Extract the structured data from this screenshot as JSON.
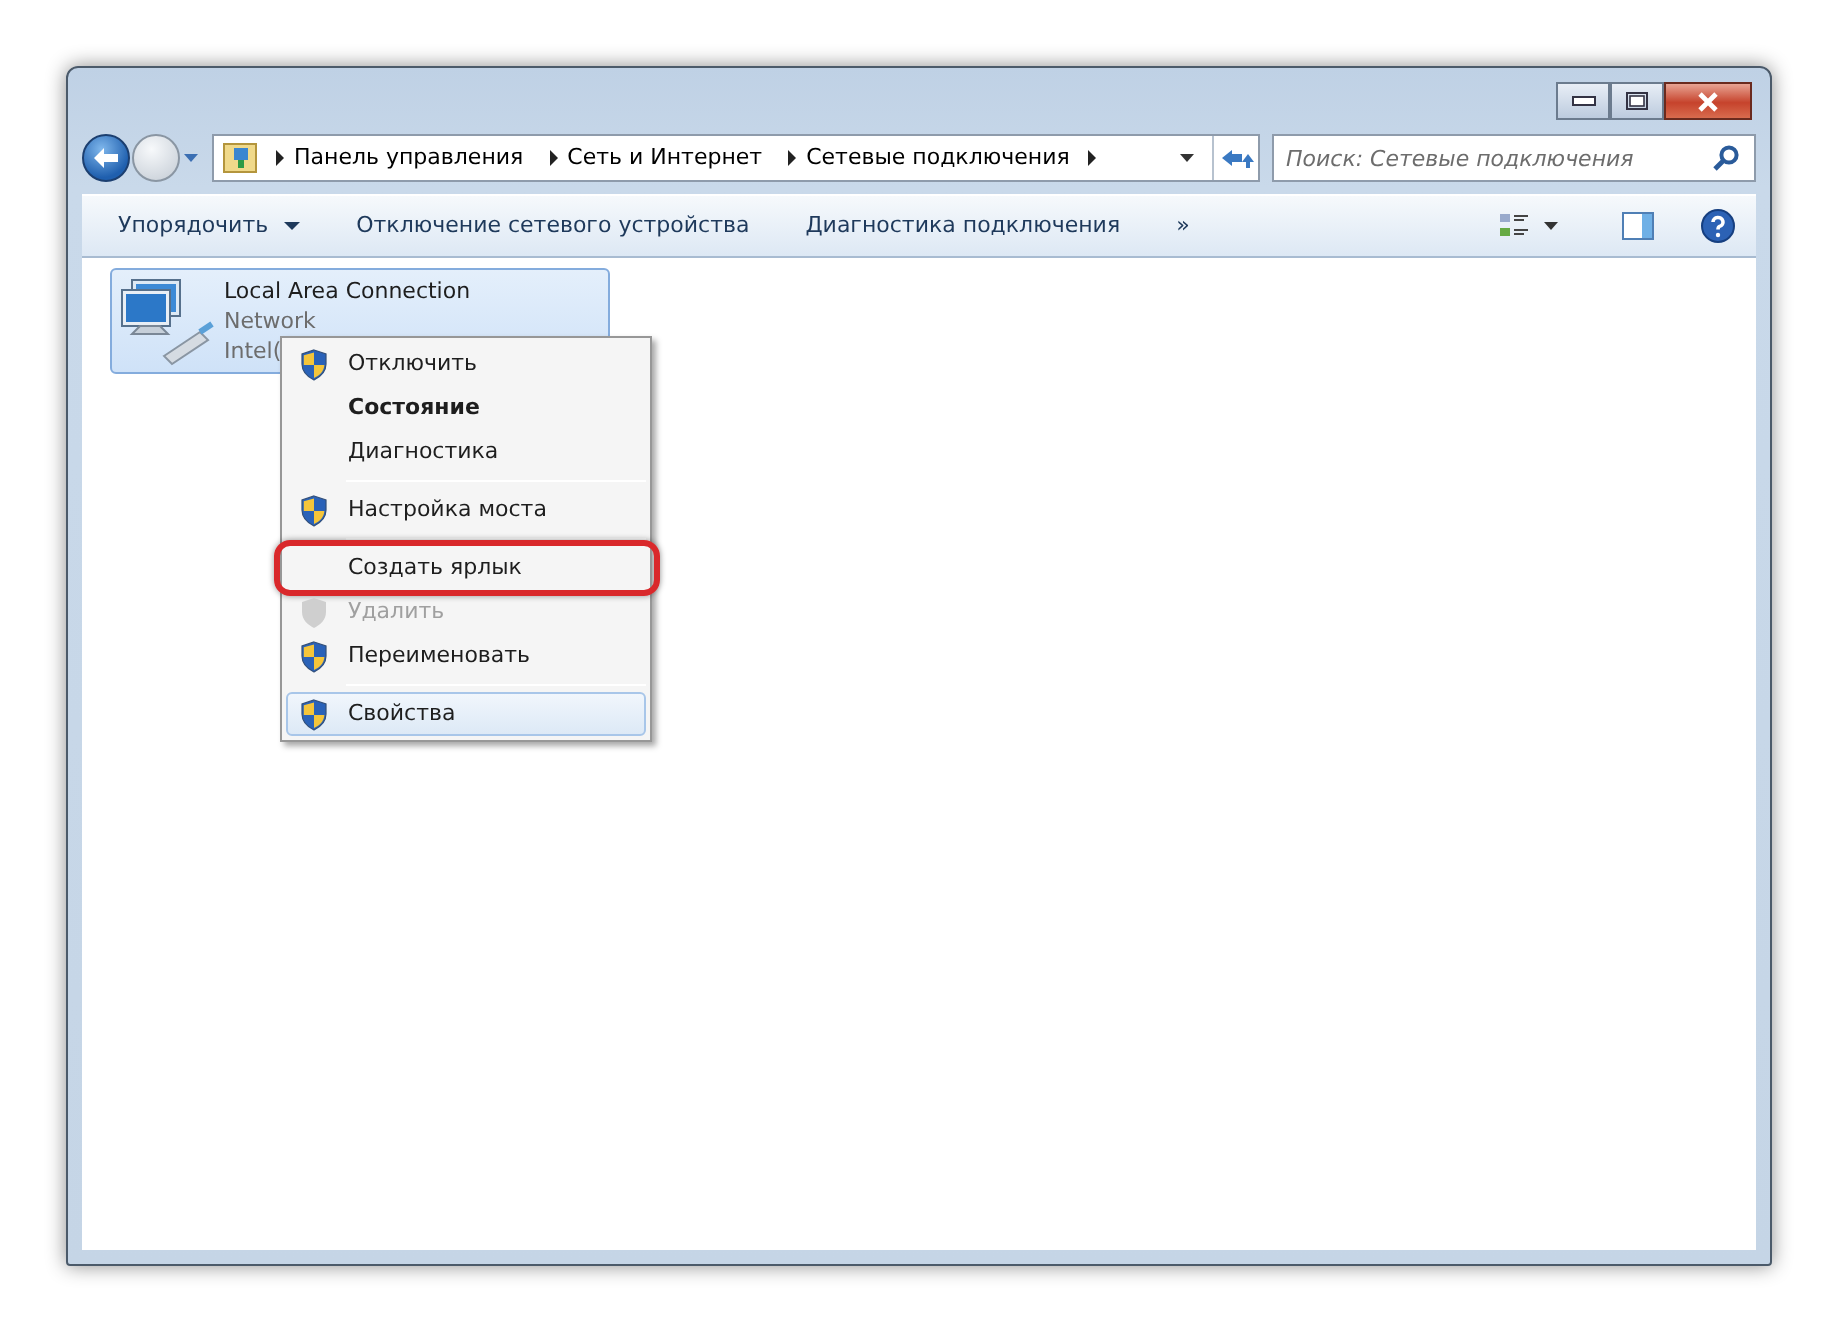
{
  "address_bar": {
    "breadcrumbs": [
      "Панель управления",
      "Сеть и Интернет",
      "Сетевые подключения"
    ]
  },
  "search": {
    "placeholder": "Поиск: Сетевые подключения"
  },
  "toolbar": {
    "items": [
      {
        "label": "Упорядочить",
        "dropdown": true
      },
      {
        "label": "Отключение сетевого устройства",
        "dropdown": false
      },
      {
        "label": "Диагностика подключения",
        "dropdown": false
      }
    ],
    "overflow": "»"
  },
  "connections": [
    {
      "name": "Local Area Connection",
      "network": "Network",
      "adapter": "Intel(",
      "selected": true
    }
  ],
  "context_menu": {
    "items": [
      {
        "kind": "item",
        "label": "Отключить",
        "shield": true,
        "default": false,
        "disabled": false,
        "selected": false,
        "highlighted": false
      },
      {
        "kind": "item",
        "label": "Состояние",
        "shield": false,
        "default": true,
        "disabled": false,
        "selected": false,
        "highlighted": false
      },
      {
        "kind": "item",
        "label": "Диагностика",
        "shield": false,
        "default": false,
        "disabled": false,
        "selected": false,
        "highlighted": false
      },
      {
        "kind": "separator"
      },
      {
        "kind": "item",
        "label": "Настройка моста",
        "shield": true,
        "default": false,
        "disabled": false,
        "selected": false,
        "highlighted": false
      },
      {
        "kind": "separator"
      },
      {
        "kind": "item",
        "label": "Создать ярлык",
        "shield": false,
        "default": false,
        "disabled": false,
        "selected": false,
        "highlighted": true
      },
      {
        "kind": "item",
        "label": "Удалить",
        "shield": true,
        "default": false,
        "disabled": true,
        "selected": false,
        "highlighted": false
      },
      {
        "kind": "item",
        "label": "Переименовать",
        "shield": true,
        "default": false,
        "disabled": false,
        "selected": false,
        "highlighted": false
      },
      {
        "kind": "separator"
      },
      {
        "kind": "item",
        "label": "Свойства",
        "shield": true,
        "default": false,
        "disabled": false,
        "selected": true,
        "highlighted": false
      }
    ]
  }
}
